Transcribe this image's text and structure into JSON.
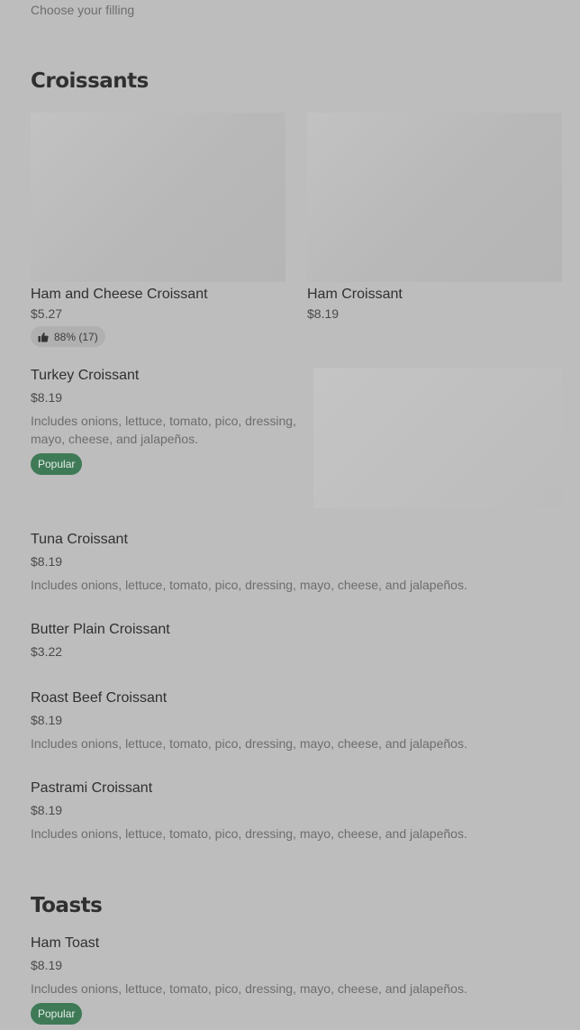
{
  "header": {
    "choose_filling": "Choose your filling"
  },
  "sections": {
    "croissants": {
      "title": "Croissants",
      "featured": [
        {
          "name": "Ham and Cheese Croissant",
          "price": "$5.27",
          "rating": "88% (17)"
        },
        {
          "name": "Ham Croissant",
          "price": "$8.19"
        }
      ],
      "items": [
        {
          "name": "Turkey Croissant",
          "price": "$8.19",
          "description": "Includes onions, lettuce, tomato, pico, dressing, mayo, cheese, and jalapeños.",
          "badge": "Popular"
        },
        {
          "name": "Tuna Croissant",
          "price": "$8.19",
          "description": "Includes onions, lettuce, tomato, pico, dressing, mayo, cheese, and jalapeños."
        },
        {
          "name": "Butter Plain Croissant",
          "price": "$3.22"
        },
        {
          "name": "Roast Beef Croissant",
          "price": "$8.19",
          "description": "Includes onions, lettuce, tomato, pico, dressing, mayo, cheese, and jalapeños."
        },
        {
          "name": "Pastrami Croissant",
          "price": "$8.19",
          "description": "Includes onions, lettuce, tomato, pico, dressing, mayo, cheese, and jalapeños."
        }
      ]
    },
    "toasts": {
      "title": "Toasts",
      "items": [
        {
          "name": "Ham Toast",
          "price": "$8.19",
          "description": "Includes onions, lettuce, tomato, pico, dressing, mayo, cheese, and jalapeños.",
          "badge": "Popular"
        }
      ]
    }
  },
  "icons": {
    "rating": "thumbs-up-icon"
  },
  "colors": {
    "background": "#bdbdbd",
    "badge": "#3f7a57",
    "badge_text": "#e6eee9"
  }
}
